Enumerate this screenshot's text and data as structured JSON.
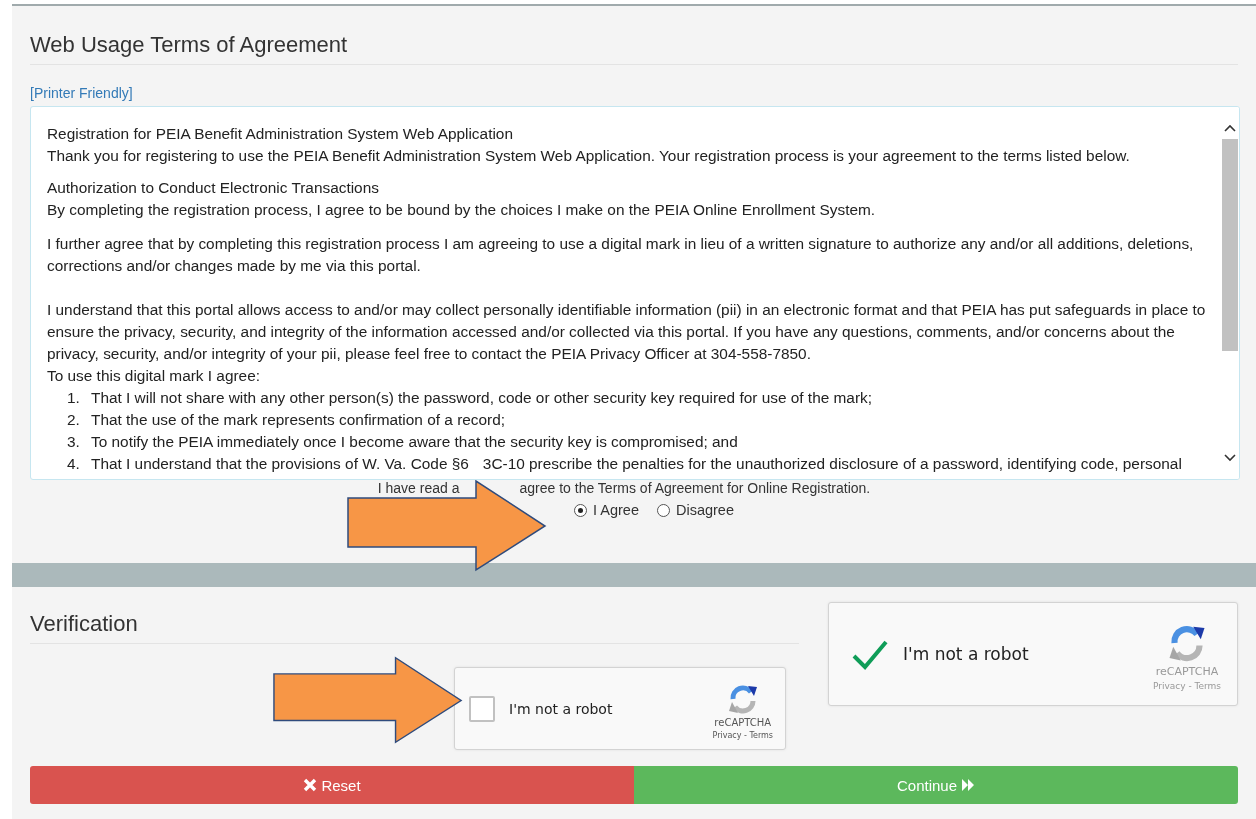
{
  "terms": {
    "title": "Web Usage Terms of Agreement",
    "printer_link": "[Printer Friendly]",
    "blocks": [
      {
        "heading": "Registration for PEIA Benefit Administration System Web Application",
        "text": "Thank you for registering to use the PEIA Benefit Administration System Web Application. Your registration process is your agreement to the terms listed below."
      },
      {
        "heading": "Authorization to Conduct Electronic Transactions",
        "text": "By completing the registration process, I agree to be bound by the choices I make on the PEIA Online Enrollment System."
      }
    ],
    "paragraphs": [
      "I further agree that by completing this registration process I am agreeing to use a digital mark in lieu of a written signature to authorize any and/or all additions, deletions, corrections and/or changes made by me via this portal.",
      "I understand that this portal allows access to and/or may collect personally identifiable information (pii) in an electronic format and that PEIA has put safeguards in place to ensure the privacy, security, and integrity of the information accessed and/or collected via this portal. If you have any questions, comments, and/or concerns about the privacy, security, and/or integrity of your pii, please feel free to contact the PEIA Privacy Officer at 304-558-7850."
    ],
    "list_intro": "To use this digital mark I agree:",
    "items": [
      {
        "number": "1.",
        "parts": [
          "That I will not share with any other person(s) the password, code or other security key required for use of the mark;"
        ]
      },
      {
        "number": "2.",
        "parts": [
          "That the use of the mark represents confirmation of a record;"
        ]
      },
      {
        "number": "3.",
        "parts": [
          "To notify the PEIA immediately once I become aware that the security key is compromised; and"
        ]
      },
      {
        "number": "4.",
        "parts": [
          "That I understand that the provisions of W. Va. Code §6",
          "3C-10 prescribe the penalties for the unauthorized disclosure of a password, identifying code, personal"
        ]
      }
    ]
  },
  "agreement": {
    "statement_parts": [
      "I have read a",
      "agree to the Terms of Agreement for Online Registration."
    ],
    "options": [
      {
        "label": "I Agree",
        "selected": true
      },
      {
        "label": "Disagree",
        "selected": false
      }
    ]
  },
  "verification": {
    "title": "Verification",
    "captchas": [
      {
        "label": "I'm not a robot",
        "checked": false,
        "brand": "reCAPTCHA",
        "links": "Privacy - Terms"
      },
      {
        "label": "I'm not a robot",
        "checked": true,
        "brand": "reCAPTCHA",
        "links": "Privacy - Terms"
      }
    ]
  },
  "buttons": [
    {
      "label": "Reset",
      "kind": "reset"
    },
    {
      "label": "Continue",
      "kind": "continue"
    }
  ]
}
